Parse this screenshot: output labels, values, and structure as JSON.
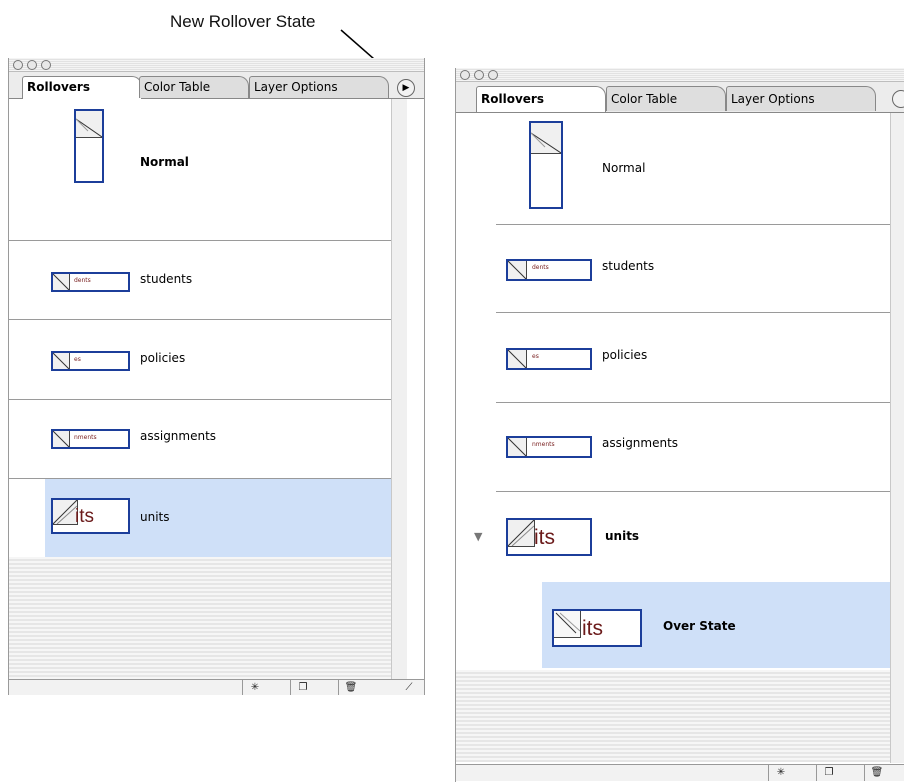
{
  "annotation": {
    "text": "New Rollover State"
  },
  "left_panel": {
    "tabs": [
      "Rollovers",
      "Color Table",
      "Layer Options"
    ],
    "menu_glyph": "▶",
    "rows": [
      {
        "label": "Normal",
        "bold": true,
        "thumb_text": ""
      },
      {
        "label": "students",
        "thumb_text": "dents"
      },
      {
        "label": "policies",
        "thumb_text": "es"
      },
      {
        "label": "assignments",
        "thumb_text": "nments"
      },
      {
        "label": "units",
        "selected": true,
        "thumb_text": "its"
      }
    ],
    "bottom_buttons": [
      "✳",
      "❐",
      "🗑"
    ]
  },
  "right_panel": {
    "tabs": [
      "Rollovers",
      "Color Table",
      "Layer Options"
    ],
    "rows": [
      {
        "label": "Normal",
        "thumb_text": ""
      },
      {
        "label": "students",
        "thumb_text": "dents"
      },
      {
        "label": "policies",
        "thumb_text": "es"
      },
      {
        "label": "assignments",
        "thumb_text": "nments"
      },
      {
        "label": "units",
        "bold": true,
        "expanded": true,
        "thumb_text": "its"
      },
      {
        "label": "Over State",
        "bold": true,
        "selected": true,
        "thumb_text": "its"
      }
    ],
    "disclosure_glyph": "▼",
    "bottom_buttons": [
      "✳",
      "❐",
      "🗑"
    ]
  },
  "colors": {
    "selection": "#cfe0f8",
    "thumb_border": "#1c3e9a"
  }
}
